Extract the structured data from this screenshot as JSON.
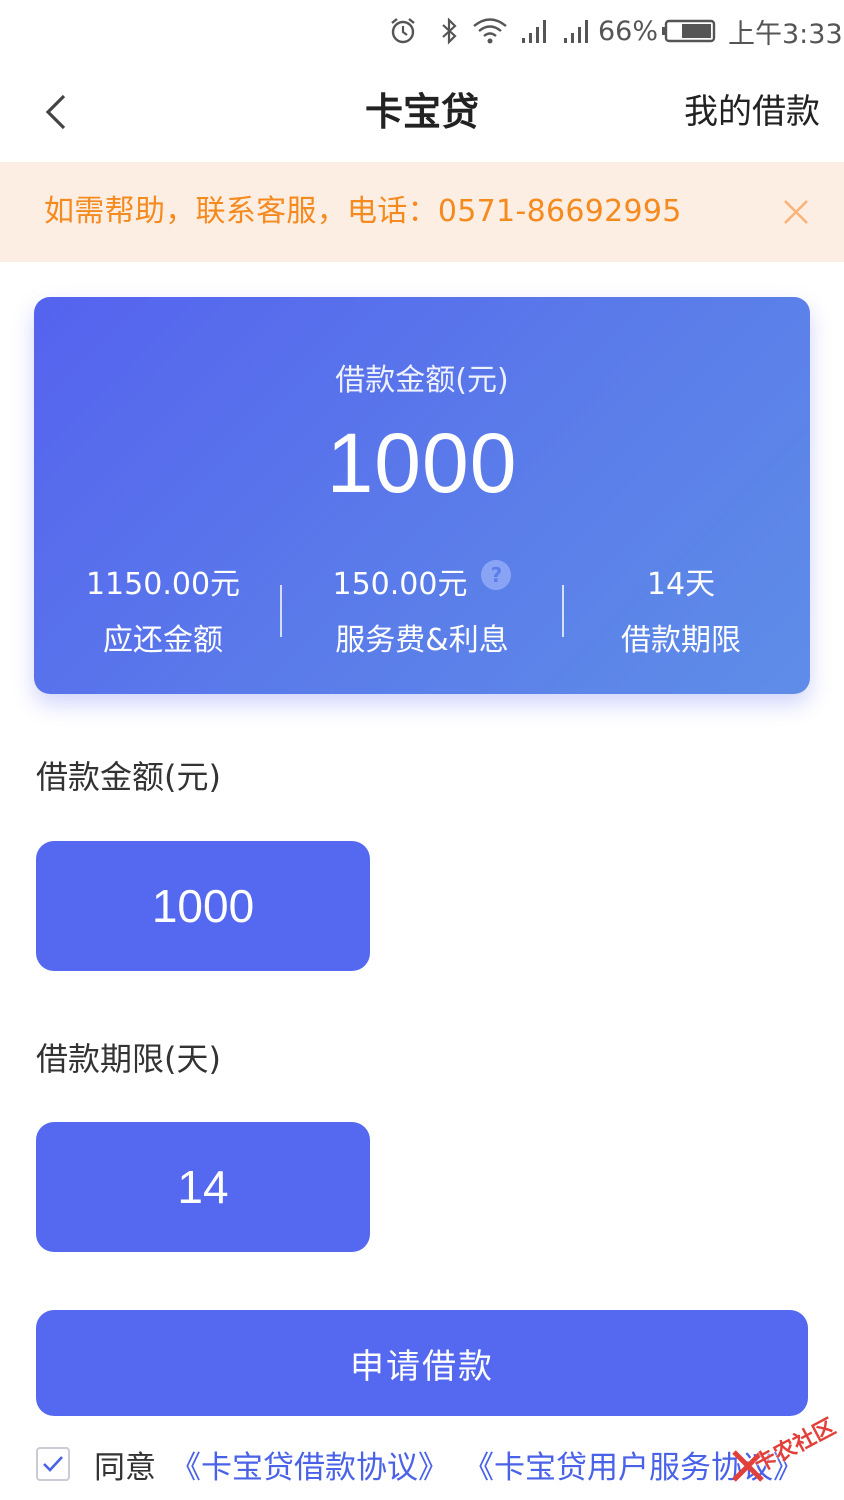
{
  "status_bar": {
    "battery_percent": "66%",
    "time": "上午3:33",
    "icons": [
      "alarm-icon",
      "bluetooth-icon",
      "wifi-icon",
      "signal-icon",
      "signal-icon",
      "battery-icon"
    ]
  },
  "header": {
    "title": "卡宝贷",
    "right_link": "我的借款",
    "back_icon": "chevron-left-icon"
  },
  "notice": {
    "text": "如需帮助，联系客服，电话：0571-86692995",
    "color": "#f58a1f",
    "background": "#fdeee3"
  },
  "summary_card": {
    "label": "借款金额(元)",
    "amount": "1000",
    "stats": [
      {
        "value": "1150.00元",
        "label": "应还金额"
      },
      {
        "value": "150.00元",
        "label": "服务费&利息",
        "help_icon": "?"
      },
      {
        "value": "14天",
        "label": "借款期限"
      }
    ]
  },
  "loan_amount": {
    "label": "借款金额(元)",
    "selected": "1000"
  },
  "loan_term": {
    "label": "借款期限(天)",
    "selected": "14"
  },
  "apply_button": "申请借款",
  "agreement": {
    "checked": true,
    "prefix": "同意",
    "links": [
      "《卡宝贷借款协议》",
      "《卡宝贷用户服务协议》"
    ]
  },
  "watermark": "卡农社区",
  "colors": {
    "primary": "#5468f0",
    "link": "#4a62e8"
  }
}
